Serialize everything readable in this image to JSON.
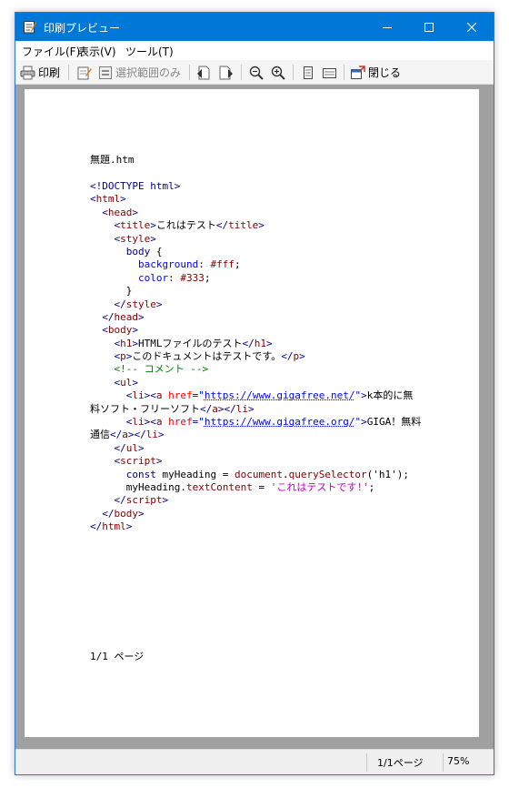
{
  "window": {
    "title": "印刷プレビュー"
  },
  "menu": [
    "ファイル(F)",
    "表示(V)",
    "ツール(T)"
  ],
  "toolbar": {
    "print_label": "印刷",
    "print_selection_label": "選択範囲のみ",
    "close_label": "閉じる"
  },
  "document": {
    "title": "無題.htm",
    "footer": "1/1 ページ",
    "code_lines": [
      [
        [
          "tag",
          "<!DOCTYPE html>"
        ]
      ],
      [
        [
          "tag",
          "<"
        ],
        [
          "tname",
          "html"
        ],
        [
          "tag",
          ">"
        ]
      ],
      [
        [
          "txt",
          "  "
        ],
        [
          "tag",
          "<"
        ],
        [
          "tname",
          "head"
        ],
        [
          "tag",
          ">"
        ]
      ],
      [
        [
          "txt",
          "    "
        ],
        [
          "tag",
          "<"
        ],
        [
          "tname",
          "title"
        ],
        [
          "tag",
          ">"
        ],
        [
          "txt",
          "これはテスト"
        ],
        [
          "tag",
          "</"
        ],
        [
          "tname",
          "title"
        ],
        [
          "tag",
          ">"
        ]
      ],
      [
        [
          "txt",
          "    "
        ],
        [
          "tag",
          "<"
        ],
        [
          "tname",
          "style"
        ],
        [
          "tag",
          ">"
        ]
      ],
      [
        [
          "txt",
          "      "
        ],
        [
          "sel",
          "body"
        ],
        [
          "txt",
          " {"
        ]
      ],
      [
        [
          "txt",
          "        "
        ],
        [
          "prop",
          "background"
        ],
        [
          "txt",
          ": "
        ],
        [
          "val",
          "#fff"
        ],
        [
          "txt",
          ";"
        ]
      ],
      [
        [
          "txt",
          "        "
        ],
        [
          "prop",
          "color"
        ],
        [
          "txt",
          ": "
        ],
        [
          "val",
          "#333"
        ],
        [
          "txt",
          ";"
        ]
      ],
      [
        [
          "txt",
          "      }"
        ]
      ],
      [
        [
          "txt",
          "    "
        ],
        [
          "tag",
          "</"
        ],
        [
          "tname",
          "style"
        ],
        [
          "tag",
          ">"
        ]
      ],
      [
        [
          "txt",
          "  "
        ],
        [
          "tag",
          "</"
        ],
        [
          "tname",
          "head"
        ],
        [
          "tag",
          ">"
        ]
      ],
      [
        [
          "txt",
          "  "
        ],
        [
          "tag",
          "<"
        ],
        [
          "tname",
          "body"
        ],
        [
          "tag",
          ">"
        ]
      ],
      [
        [
          "txt",
          "    "
        ],
        [
          "tag",
          "<"
        ],
        [
          "tname",
          "h1"
        ],
        [
          "tag",
          ">"
        ],
        [
          "txt",
          "HTMLファイルのテスト"
        ],
        [
          "tag",
          "</"
        ],
        [
          "tname",
          "h1"
        ],
        [
          "tag",
          ">"
        ]
      ],
      [
        [
          "txt",
          "    "
        ],
        [
          "tag",
          "<"
        ],
        [
          "tname",
          "p"
        ],
        [
          "tag",
          ">"
        ],
        [
          "txt",
          "このドキュメントはテストです。"
        ],
        [
          "tag",
          "</"
        ],
        [
          "tname",
          "p"
        ],
        [
          "tag",
          ">"
        ]
      ],
      [
        [
          "txt",
          "    "
        ],
        [
          "cmt",
          "<!-- コメント -->"
        ]
      ],
      [
        [
          "txt",
          "    "
        ],
        [
          "tag",
          "<"
        ],
        [
          "tname",
          "ul"
        ],
        [
          "tag",
          ">"
        ]
      ],
      [
        [
          "txt",
          "      "
        ],
        [
          "tag",
          "<"
        ],
        [
          "tname",
          "li"
        ],
        [
          "tag",
          "><"
        ],
        [
          "tname",
          "a"
        ],
        [
          "txt",
          " "
        ],
        [
          "attr",
          "href"
        ],
        [
          "tag",
          "="
        ],
        [
          "str",
          "\""
        ],
        [
          "link",
          "https://www.gigafree.net/"
        ],
        [
          "str",
          "\""
        ],
        [
          "tag",
          ">"
        ],
        [
          "txt",
          "k本的に無"
        ]
      ],
      [
        [
          "txt",
          "料ソフト・フリーソフト"
        ],
        [
          "tag",
          "</"
        ],
        [
          "tname",
          "a"
        ],
        [
          "tag",
          "></"
        ],
        [
          "tname",
          "li"
        ],
        [
          "tag",
          ">"
        ]
      ],
      [
        [
          "txt",
          "      "
        ],
        [
          "tag",
          "<"
        ],
        [
          "tname",
          "li"
        ],
        [
          "tag",
          "><"
        ],
        [
          "tname",
          "a"
        ],
        [
          "txt",
          " "
        ],
        [
          "attr",
          "href"
        ],
        [
          "tag",
          "="
        ],
        [
          "str",
          "\""
        ],
        [
          "link",
          "https://www.gigafree.org/"
        ],
        [
          "str",
          "\""
        ],
        [
          "tag",
          ">"
        ],
        [
          "txt",
          "GIGA！無料"
        ]
      ],
      [
        [
          "txt",
          "通信"
        ],
        [
          "tag",
          "</"
        ],
        [
          "tname",
          "a"
        ],
        [
          "tag",
          "></"
        ],
        [
          "tname",
          "li"
        ],
        [
          "tag",
          ">"
        ]
      ],
      [
        [
          "txt",
          "    "
        ],
        [
          "tag",
          "</"
        ],
        [
          "tname",
          "ul"
        ],
        [
          "tag",
          ">"
        ]
      ],
      [
        [
          "txt",
          "    "
        ],
        [
          "tag",
          "<"
        ],
        [
          "tname",
          "script"
        ],
        [
          "tag",
          ">"
        ]
      ],
      [
        [
          "txt",
          "      "
        ],
        [
          "kw",
          "const"
        ],
        [
          "txt",
          " myHeading = "
        ],
        [
          "val",
          "document"
        ],
        [
          "txt",
          "."
        ],
        [
          "val",
          "querySelector"
        ],
        [
          "txt",
          "('h1');"
        ]
      ],
      [
        [
          "txt",
          "      myHeading."
        ],
        [
          "val",
          "textContent"
        ],
        [
          "txt",
          " = "
        ],
        [
          "jsstr",
          "'これはテストです!'"
        ],
        [
          "txt",
          ";"
        ]
      ],
      [
        [
          "txt",
          "    "
        ],
        [
          "tag",
          "</"
        ],
        [
          "tname",
          "script"
        ],
        [
          "tag",
          ">"
        ]
      ],
      [
        [
          "txt",
          "  "
        ],
        [
          "tag",
          "</"
        ],
        [
          "tname",
          "body"
        ],
        [
          "tag",
          ">"
        ]
      ],
      [
        [
          "tag",
          "</"
        ],
        [
          "tname",
          "html"
        ],
        [
          "tag",
          ">"
        ]
      ]
    ]
  },
  "status": {
    "page": "1/1ページ",
    "zoom": "75%"
  }
}
